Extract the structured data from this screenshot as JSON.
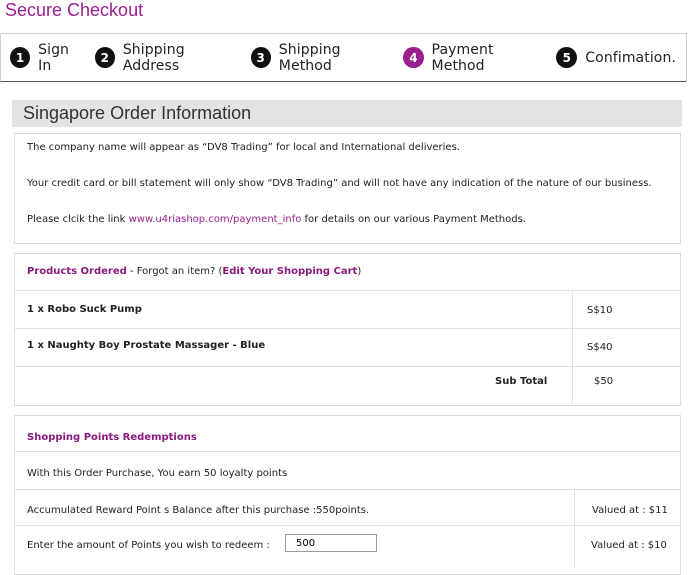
{
  "page_title": "Secure Checkout",
  "steps": [
    {
      "num": "1",
      "label": "Sign In"
    },
    {
      "num": "2",
      "label": "Shipping Address"
    },
    {
      "num": "3",
      "label": "Shipping Method"
    },
    {
      "num": "4",
      "label": "Payment Method",
      "active": true
    },
    {
      "num": "5",
      "label": "Confimation."
    }
  ],
  "section_title": "Singapore Order Information",
  "info": {
    "line1": "The company name will appear as “DV8 Trading” for local and International deliveries.",
    "line2": "Your credit card or bill statement will only show “DV8 Trading” and will not have any indication of the nature of our business.",
    "line3_prefix": "Please clcik the link ",
    "line3_link": "www.u4riashop.com/payment_info",
    "line3_suffix": " for details on our various Payment Methods."
  },
  "products": {
    "heading": "Products Ordered",
    "forgot_text": " - Forgot an item? (",
    "edit_link": "Edit Your Shopping Cart",
    "close_paren": ")",
    "items": [
      {
        "name": "1 x Robo Suck Pump",
        "price": "S$10"
      },
      {
        "name": "1 x Naughty Boy Prostate Massager - Blue",
        "price": "S$40"
      }
    ],
    "subtotal_label": "Sub Total",
    "subtotal_value": "$50"
  },
  "points": {
    "heading": "Shopping Points Redemptions",
    "earn_text": "With this Order Purchase, You earn 50 loyalty points",
    "balance_text": "Accumulated  Reward Point s Balance after this purchase :550points.",
    "balance_value": "Valued at : $11",
    "redeem_label": "Enter the amount of Points you wish to redeem  :",
    "redeem_input": "500",
    "redeem_value": "Valued at : $10"
  },
  "colors": {
    "accent": "#9b1f8f",
    "step_dark": "#111111"
  }
}
